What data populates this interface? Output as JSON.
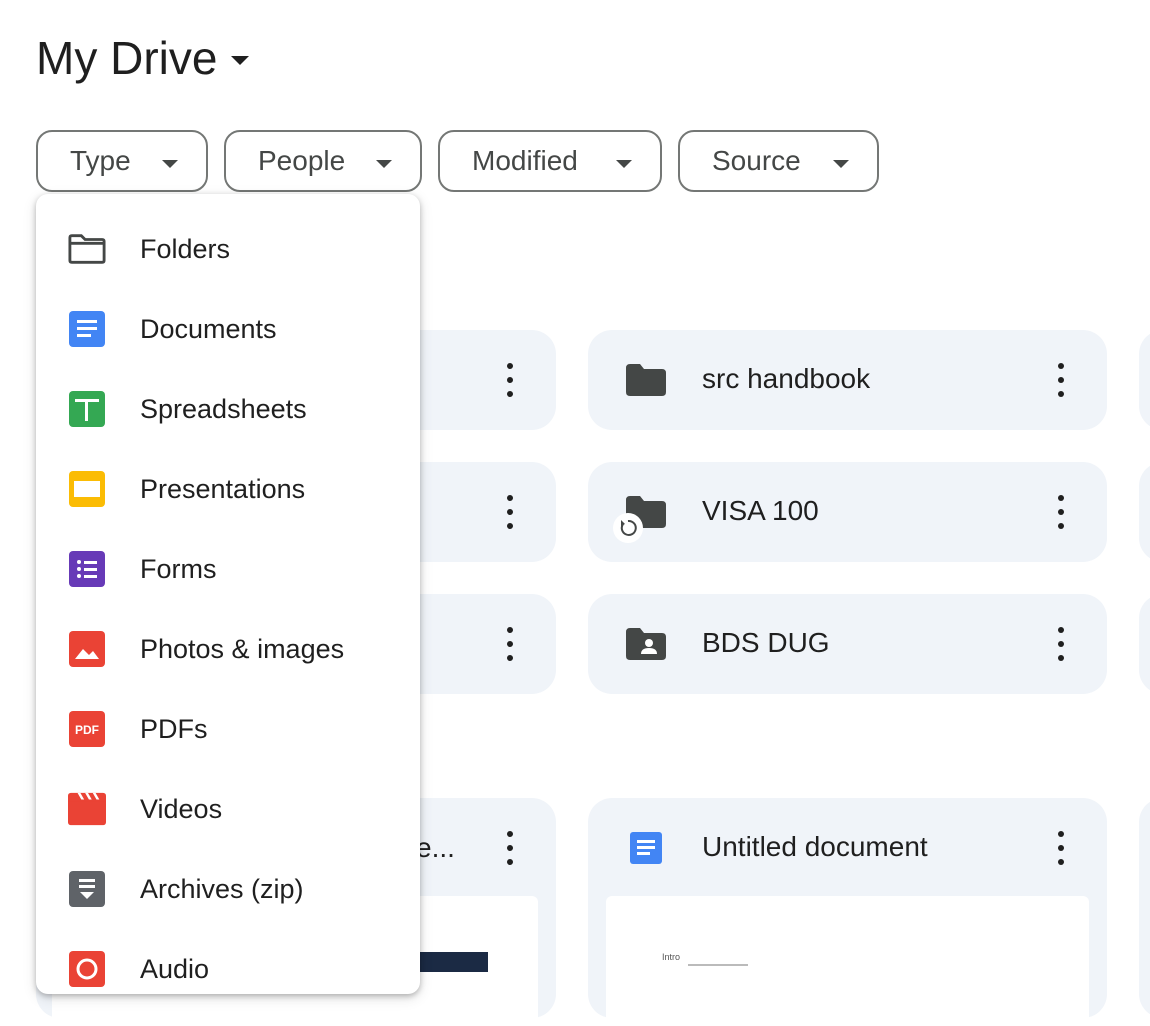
{
  "header": {
    "title": "My Drive"
  },
  "filters": [
    {
      "label": "Type"
    },
    {
      "label": "People"
    },
    {
      "label": "Modified"
    },
    {
      "label": "Source"
    }
  ],
  "folders": [
    {
      "name": "src handbook",
      "icon": "folder-icon"
    },
    {
      "name": "VISA 100",
      "icon": "folder-icon",
      "badge": "sync-badge-icon"
    },
    {
      "name": "BDS DUG",
      "icon": "shared-folder-icon"
    }
  ],
  "files": [
    {
      "name": "e...",
      "icon": "image-file-icon"
    },
    {
      "name": "Untitled document",
      "icon": "document-icon",
      "preview_text": "Intro"
    }
  ],
  "type_menu": {
    "items": [
      {
        "label": "Folders",
        "icon": "folder-outline-icon",
        "color": "#444746"
      },
      {
        "label": "Documents",
        "icon": "docs-icon",
        "color": "#4285f4"
      },
      {
        "label": "Spreadsheets",
        "icon": "sheets-icon",
        "color": "#34a853"
      },
      {
        "label": "Presentations",
        "icon": "slides-icon",
        "color": "#fbbc04"
      },
      {
        "label": "Forms",
        "icon": "forms-icon",
        "color": "#673ab7"
      },
      {
        "label": "Photos & images",
        "icon": "image-icon",
        "color": "#ea4335"
      },
      {
        "label": "PDFs",
        "icon": "pdf-icon",
        "color": "#ea4335",
        "icon_text": "PDF"
      },
      {
        "label": "Videos",
        "icon": "video-icon",
        "color": "#ea4335"
      },
      {
        "label": "Archives (zip)",
        "icon": "archive-icon",
        "color": "#5f6368"
      },
      {
        "label": "Audio",
        "icon": "audio-icon",
        "color": "#ea4335"
      }
    ]
  },
  "colors": {
    "card_bg": "#f0f4f9",
    "chip_border": "#747775",
    "text": "#1f1f1f"
  }
}
